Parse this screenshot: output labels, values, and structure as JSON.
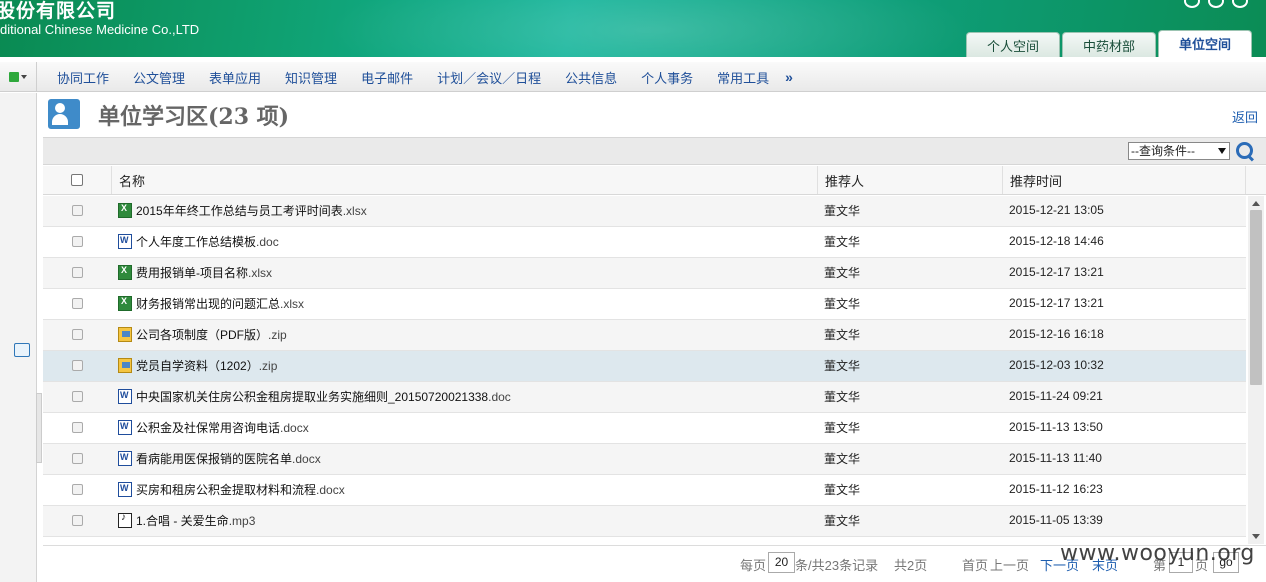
{
  "header": {
    "company_cn": "股份有限公司",
    "company_en": "ditional Chinese Medicine Co.,LTD",
    "tabs": [
      {
        "label": "个人空间",
        "active": false
      },
      {
        "label": "中药材部",
        "active": false
      },
      {
        "label": "单位空间",
        "active": true
      }
    ]
  },
  "nav": {
    "items": [
      "协同工作",
      "公文管理",
      "表单应用",
      "知识管理",
      "电子邮件",
      "计划／会议／日程",
      "公共信息",
      "个人事务",
      "常用工具"
    ],
    "more": "»"
  },
  "page": {
    "title": "单位学习区(23 项)",
    "back": "返回"
  },
  "search": {
    "select_value": "--查询条件--"
  },
  "table": {
    "headers": {
      "name": "名称",
      "recommender": "推荐人",
      "time": "推荐时间"
    },
    "rows": [
      {
        "icon": "excel-icon",
        "name": "2015年年终工作总结与员工考评时间表",
        "ext": ".xlsx",
        "by": "董文华",
        "time": "2015-12-21 13:05"
      },
      {
        "icon": "word-icon",
        "name": "个人年度工作总结模板",
        "ext": ".doc",
        "by": "董文华",
        "time": "2015-12-18 14:46"
      },
      {
        "icon": "excel-icon",
        "name": "费用报销单-项目名称",
        "ext": ".xlsx",
        "by": "董文华",
        "time": "2015-12-17 13:21"
      },
      {
        "icon": "excel-icon",
        "name": "财务报销常出现的问题汇总",
        "ext": ".xlsx",
        "by": "董文华",
        "time": "2015-12-17 13:21"
      },
      {
        "icon": "zip-icon",
        "name": "公司各项制度（PDF版）",
        "ext": ".zip",
        "by": "董文华",
        "time": "2015-12-16 16:18"
      },
      {
        "icon": "zip-icon",
        "name": "党员自学资料（1202）",
        "ext": ".zip",
        "by": "董文华",
        "time": "2015-12-03 10:32"
      },
      {
        "icon": "word-icon",
        "name": "中央国家机关住房公积金租房提取业务实施细则_20150720021338",
        "ext": ".doc",
        "by": "董文华",
        "time": "2015-11-24 09:21"
      },
      {
        "icon": "word-icon",
        "name": "公积金及社保常用咨询电话",
        "ext": ".docx",
        "by": "董文华",
        "time": "2015-11-13 13:50"
      },
      {
        "icon": "word-icon",
        "name": "看病能用医保报销的医院名单",
        "ext": ".docx",
        "by": "董文华",
        "time": "2015-11-13 11:40"
      },
      {
        "icon": "word-icon",
        "name": "买房和租房公积金提取材料和流程",
        "ext": ".docx",
        "by": "董文华",
        "time": "2015-11-12 16:23"
      },
      {
        "icon": "audio-icon",
        "name": "1.合唱 - 关爱生命",
        "ext": ".mp3",
        "by": "董文华",
        "time": "2015-11-05 13:39"
      }
    ]
  },
  "pager": {
    "per_page_label": "每页",
    "per_page_value": "20",
    "records_text": "条/共23条记录",
    "pages_text": "共2页",
    "first": "首页",
    "prev": "上一页",
    "next": "下一页",
    "last": "末页",
    "page_label": "第",
    "page_value": "1",
    "page_suffix": "页",
    "go": "go"
  },
  "watermark": "www.wooyun.org"
}
